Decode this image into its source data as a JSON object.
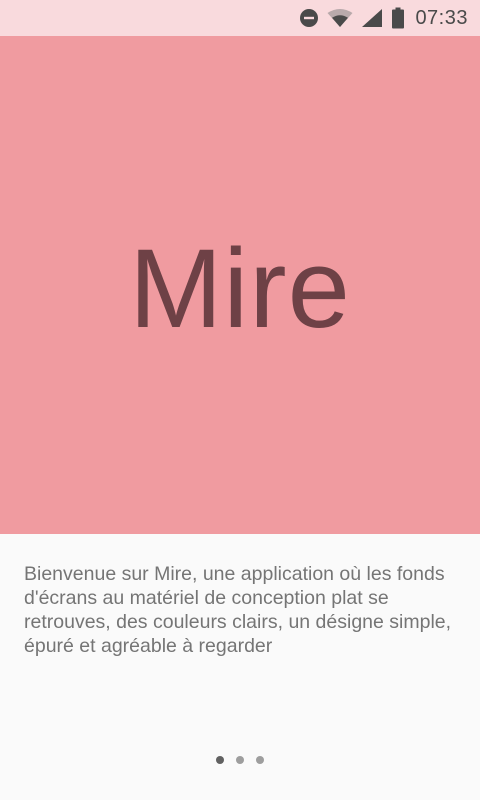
{
  "status_bar": {
    "time": "07:33",
    "icons": [
      "do-not-disturb-icon",
      "wifi-icon",
      "signal-icon",
      "battery-icon"
    ]
  },
  "hero": {
    "title": "Mire",
    "background_color": "#f09ba0",
    "text_color": "#6e4146"
  },
  "intro": {
    "description": "Bienvenue sur Mire, une application où les fonds d'écrans au matériel de conception plat se retrouves, des couleurs clairs, un désigne simple, épuré et agréable à regarder"
  },
  "pager": {
    "page_count": 3,
    "current_page": 1
  }
}
